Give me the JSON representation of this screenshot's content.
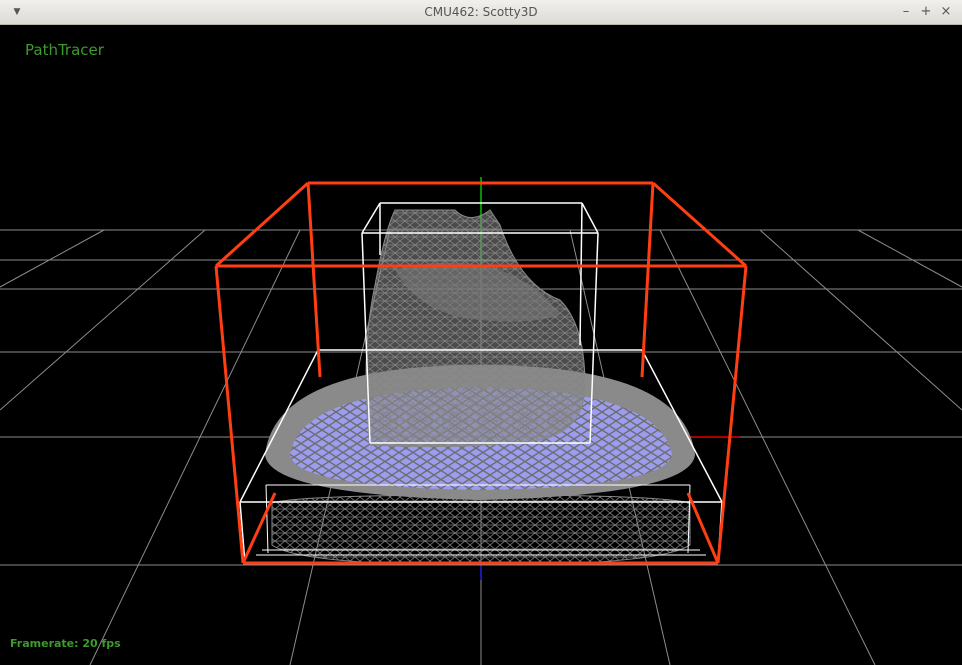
{
  "window": {
    "title": "CMU462: Scotty3D",
    "menu_icon": "chevron-down-icon",
    "minimize_icon": "minimize-icon",
    "maximize_icon": "maximize-icon",
    "close_icon": "close-icon",
    "minimize_glyph": "–",
    "maximize_glyph": "+",
    "close_glyph": "×",
    "menu_glyph": "▼"
  },
  "viewport": {
    "mode": "PathTracer",
    "framerate": "Framerate: 20 fps"
  },
  "colors": {
    "background": "#000000",
    "grid": "#8c8c8c",
    "bvh_root_box": "#ff3f13",
    "bvh_child_box": "#ffffff",
    "mesh_wire": "#8a8a8a",
    "mesh_fill": "#9c9cf0",
    "axis_y": "#00c000",
    "axis_x": "#e00000",
    "axis_z": "#2020e0",
    "hud_text": "#3c9b2a"
  }
}
